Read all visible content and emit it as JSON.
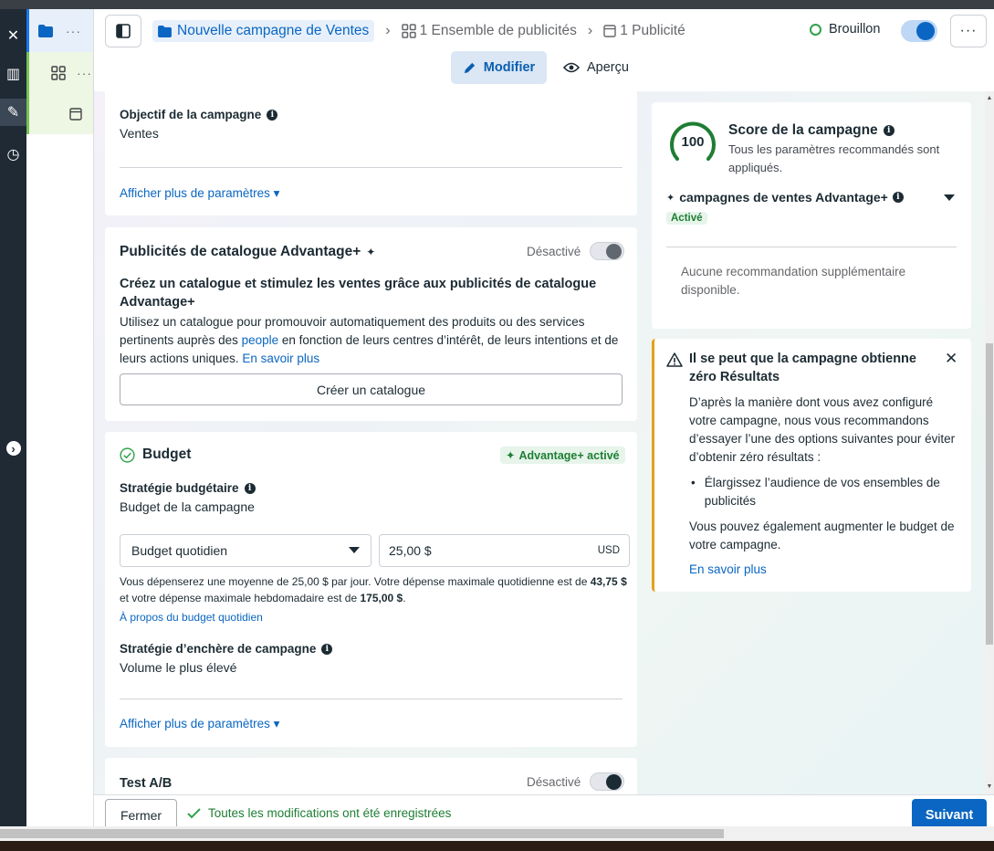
{
  "rail": {
    "close": "✕",
    "chart": "▥",
    "edit": "✎",
    "history": "◷",
    "expand": "›"
  },
  "tree": {
    "dots": "···"
  },
  "header": {
    "crumb_campaign": "Nouvelle campagne de Ventes",
    "crumb_adset": "1 Ensemble de publicités",
    "crumb_ad": "1 Publicité",
    "separator": "›",
    "status": "Brouillon",
    "more": "···",
    "mode_edit": "Modifier",
    "mode_preview": "Aperçu"
  },
  "objective": {
    "label": "Objectif de la campagne",
    "value": "Ventes",
    "more_link": "Afficher plus de paramètres ▾"
  },
  "catalog": {
    "title": "Publicités de catalogue Advantage+",
    "sparkle": "✦",
    "toggle_label": "Désactivé",
    "headline": "Créez un catalogue et stimulez les ventes grâce aux publicités de catalogue Advantage+",
    "desc_before": "Utilisez un catalogue pour promouvoir automatiquement des produits ou des services pertinents auprès des ",
    "desc_link": "people",
    "desc_after": " en fonction de leurs centres d’intérêt, de leurs intentions et de leurs actions uniques. ",
    "learn_more": "En savoir plus",
    "button": "Créer un catalogue"
  },
  "budget": {
    "title": "Budget",
    "badge": "Advantage+ activé",
    "strategy_label": "Stratégie budgétaire",
    "strategy_value": "Budget de la campagne",
    "select_value": "Budget quotidien",
    "amount": "25,00 $",
    "currency": "USD",
    "note_1": "Vous dépenserez une moyenne de 25,00 $ par jour. Votre dépense maximale quotidienne est de ",
    "note_daily_max": "43,75 $",
    "note_2": " et votre dépense maximale hebdomadaire est de ",
    "note_weekly_max": "175,00 $",
    "note_3": ".",
    "about_link": "À propos du budget quotidien",
    "bid_label": "Stratégie d’enchère de campagne",
    "bid_value": "Volume le plus élevé",
    "more_link": "Afficher plus de paramètres ▾"
  },
  "abtest": {
    "title": "Test A/B",
    "toggle_label": "Désactivé"
  },
  "score": {
    "value": "100",
    "title": "Score de la campagne",
    "desc": "Tous les paramètres recommandés sont appliqués.",
    "advantage_title": "campagnes de ventes Advantage+",
    "sparkle": "✦",
    "advantage_status": "Activé",
    "no_reco": "Aucune recommandation supplémentaire disponible."
  },
  "warning": {
    "title": "Il se peut que la campagne obtienne zéro Résultats",
    "body": "D’après la manière dont vous avez configuré votre campagne, nous vous recommandons d’essayer l’une des options suivantes pour éviter d’obtenir zéro résultats :",
    "bullet": "Élargissez l’audience de vos ensembles de publicités",
    "body2": "Vous pouvez également augmenter le budget de votre campagne.",
    "link": "En savoir plus"
  },
  "footer": {
    "close": "Fermer",
    "saved": "Toutes les modifications ont été enregistrées",
    "next": "Suivant"
  },
  "colors": {
    "accent": "#0a66c2",
    "success": "#31a24c",
    "warning": "#e4a11b"
  }
}
